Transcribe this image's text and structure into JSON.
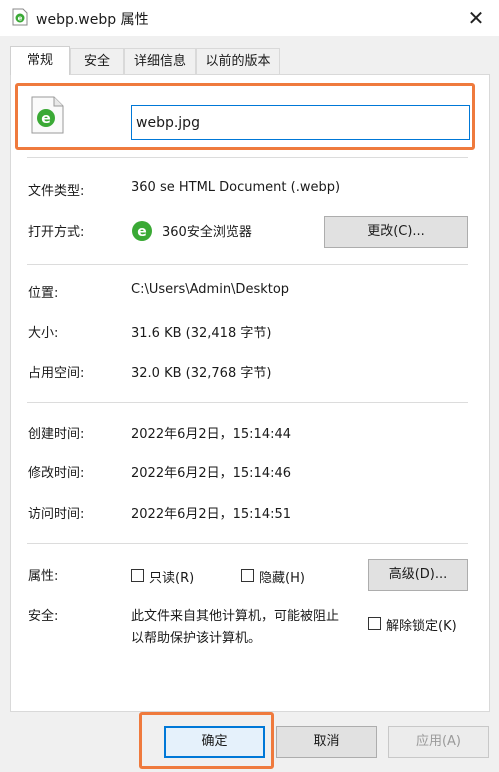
{
  "window": {
    "title": "webp.webp 属性",
    "close_glyph": "✕",
    "file_icon": "ie-file-icon"
  },
  "tabs": [
    {
      "label": "常规",
      "active": true
    },
    {
      "label": "安全",
      "active": false
    },
    {
      "label": "详细信息",
      "active": false
    },
    {
      "label": "以前的版本",
      "active": false
    }
  ],
  "file": {
    "name": "webp.jpg",
    "icon_name": "360-browser-file-icon"
  },
  "details": {
    "type_label": "文件类型:",
    "type_value": "360 se HTML Document (.webp)",
    "open_label": "打开方式:",
    "open_value": "360安全浏览器",
    "change_btn": "更改(C)...",
    "location_label": "位置:",
    "location_value": "C:\\Users\\Admin\\Desktop",
    "size_label": "大小:",
    "size_value": "31.6 KB (32,418 字节)",
    "disk_label": "占用空间:",
    "disk_value": "32.0 KB (32,768 字节)",
    "created_label": "创建时间:",
    "created_value": "2022年6月2日，15:14:44",
    "modified_label": "修改时间:",
    "modified_value": "2022年6月2日，15:14:46",
    "accessed_label": "访问时间:",
    "accessed_value": "2022年6月2日，15:14:51",
    "attr_label": "属性:",
    "readonly_label": "只读(R)",
    "hidden_label": "隐藏(H)",
    "advanced_btn": "高级(D)...",
    "security_label": "安全:",
    "security_line1": "此文件来自其他计算机，可能被阻止",
    "security_line2": "以帮助保护该计算机。",
    "unblock_label": "解除锁定(K)"
  },
  "buttons": {
    "ok": "确定",
    "cancel": "取消",
    "apply": "应用(A)"
  },
  "colors": {
    "highlight": "#ef7a3d",
    "focus_blue": "#0078d7",
    "ie_green": "#3aa935"
  }
}
